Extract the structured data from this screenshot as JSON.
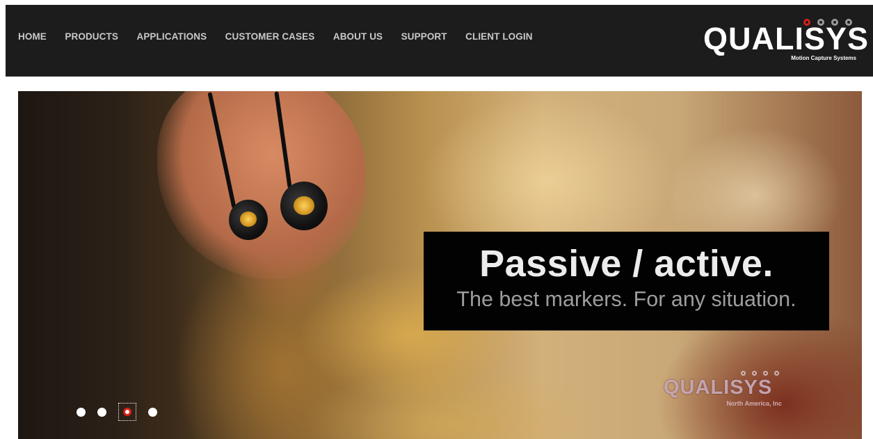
{
  "nav": {
    "items": [
      {
        "label": "HOME"
      },
      {
        "label": "PRODUCTS"
      },
      {
        "label": "APPLICATIONS"
      },
      {
        "label": "CUSTOMER CASES"
      },
      {
        "label": "ABOUT US"
      },
      {
        "label": "SUPPORT"
      },
      {
        "label": "CLIENT LOGIN"
      }
    ]
  },
  "logo": {
    "name": "QUALISYS",
    "tagline": "Motion Capture Systems"
  },
  "hero": {
    "headline": "Passive / active.",
    "subheadline": "The best markers. For any situation.",
    "watermark_name": "QUALISYS",
    "watermark_tagline": "North America, Inc",
    "slide_count": 4,
    "active_slide": 3
  },
  "colors": {
    "topbar_bg": "#1c1c1c",
    "nav_text": "#c9c9c9",
    "brand_red": "#d8201c",
    "caption_bg": "#020202"
  }
}
